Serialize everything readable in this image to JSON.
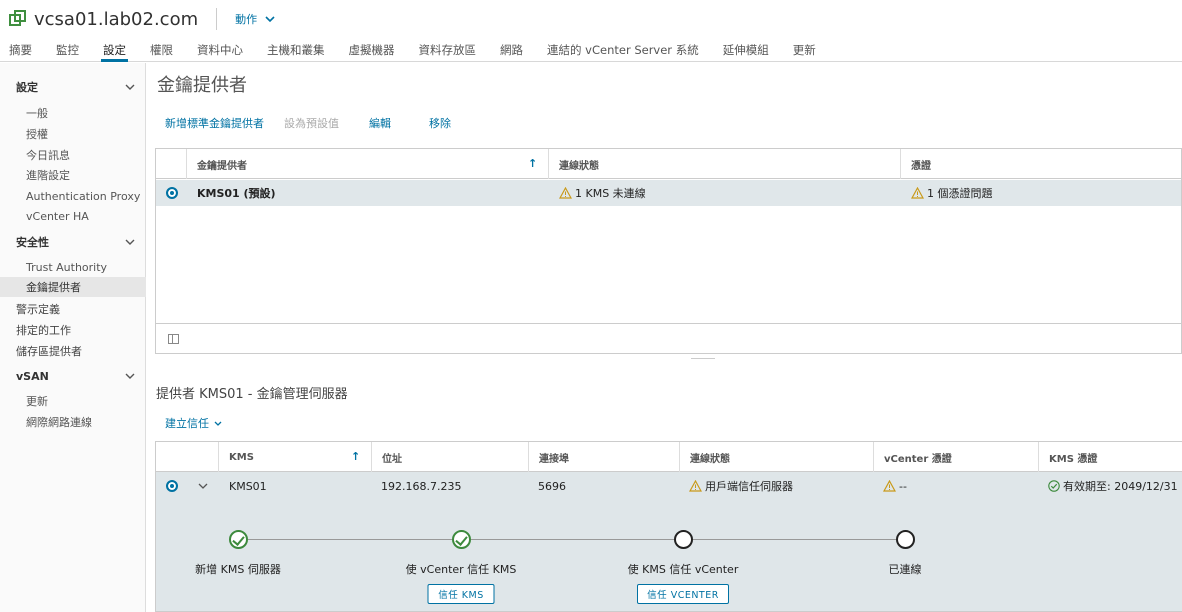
{
  "header": {
    "host_name": "vcsa01.lab02.com",
    "actions_label": "動作",
    "tabs": [
      "摘要",
      "監控",
      "設定",
      "權限",
      "資料中心",
      "主機和叢集",
      "虛擬機器",
      "資料存放區",
      "網路",
      "連結的 vCenter Server 系統",
      "延伸模組",
      "更新"
    ],
    "active_tab": "設定"
  },
  "sidebar": {
    "group_settings": "設定",
    "settings_items": [
      "一般",
      "授權",
      "今日訊息",
      "進階設定",
      "Authentication Proxy",
      "vCenter HA"
    ],
    "group_security": "安全性",
    "security_items": [
      "Trust Authority",
      "金鑰提供者"
    ],
    "top_items": [
      "警示定義",
      "排定的工作",
      "儲存區提供者"
    ],
    "group_vsan": "vSAN",
    "vsan_items": [
      "更新",
      "網際網路連線"
    ]
  },
  "main": {
    "title": "金鑰提供者",
    "toolbar": {
      "add": "新增標準金鑰提供者",
      "set_default": "設為預設值",
      "edit": "編輯",
      "remove": "移除"
    },
    "providers_grid": {
      "columns": [
        "金鑰提供者",
        "連線狀態",
        "憑證"
      ],
      "rows": [
        {
          "name": "KMS01 (預設)",
          "status": "1 KMS 未連線",
          "cert": "1 個憑證問題"
        }
      ]
    },
    "section_title": "提供者 KMS01 - 金鑰管理伺服器",
    "trust_menu": "建立信任",
    "kms_grid": {
      "columns": [
        "KMS",
        "位址",
        "連接埠",
        "連線狀態",
        "vCenter 憑證",
        "KMS 憑證"
      ],
      "rows": [
        {
          "kms": "KMS01",
          "address": "192.168.7.235",
          "port": "5696",
          "status": "用戶端信任伺服器",
          "vcenter_cert": "--",
          "kms_cert": "有效期至: 2049/12/31"
        }
      ]
    },
    "steps": [
      {
        "label": "新增 KMS 伺服器",
        "done": true
      },
      {
        "label": "使 vCenter 信任 KMS",
        "done": true,
        "button": "信任 KMS"
      },
      {
        "label": "使 KMS 信任 vCenter",
        "done": false,
        "button": "信任 VCENTER"
      },
      {
        "label": "已連線",
        "done": false
      }
    ]
  },
  "colors": {
    "accent": "#0072a3",
    "warning": "#c99a1a",
    "success": "#3d8a3d",
    "selected_row": "#e0e7ea"
  }
}
